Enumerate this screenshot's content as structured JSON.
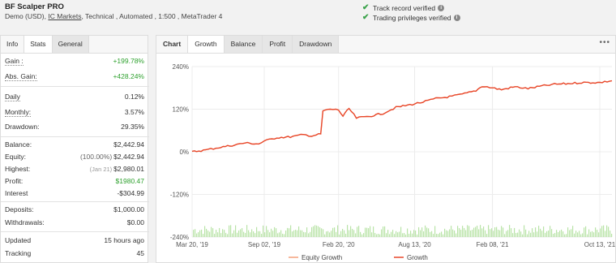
{
  "header": {
    "title": "BF Scalper PRO",
    "sub_pre": "Demo (USD),",
    "broker": "IC Markets",
    "sub_post": ", Technical , Automated , 1:500 , MetaTrader 4",
    "verified1": "Track record verified",
    "verified2": "Trading privileges verified"
  },
  "left": {
    "tabs": [
      "Info",
      "Stats",
      "General"
    ],
    "gain_label": "Gain :",
    "gain_value": "+199.78%",
    "abs_label": "Abs. Gain:",
    "abs_value": "+428.24%",
    "daily_label": "Daily",
    "daily_value": "0.12%",
    "monthly_label": "Monthly:",
    "monthly_value": "3.57%",
    "drawdown_label": "Drawdown:",
    "drawdown_value": "29.35%",
    "balance_label": "Balance:",
    "balance_value": "$2,442.94",
    "equity_label": "Equity:",
    "equity_pre": "(100.00%)",
    "equity_value": "$2,442.94",
    "highest_label": "Highest:",
    "highest_pre": "(Jan 21)",
    "highest_value": "$2,980.01",
    "profit_label": "Profit:",
    "profit_value": "$1980.47",
    "interest_label": "Interest",
    "interest_value": "-$304.99",
    "deposits_label": "Deposits:",
    "deposits_value": "$1,000.00",
    "withdrawals_label": "Withdrawals:",
    "withdrawals_value": "$0.00",
    "updated_label": "Updated",
    "updated_value": "15 hours ago",
    "tracking_label": "Tracking",
    "tracking_value": "45"
  },
  "chart_tabs": [
    "Chart",
    "Growth",
    "Balance",
    "Profit",
    "Drawdown"
  ],
  "chart_data": {
    "type": "line",
    "title": "",
    "xlabel": "",
    "ylabel": "",
    "x_ticks": [
      "Mar 20, '19",
      "Sep 02, '19",
      "Feb 20, '20",
      "Aug 13, '20",
      "Feb 08, '21",
      "Oct 13, '21"
    ],
    "y_ticks": [
      "240%",
      "120%",
      "0%",
      "-120%",
      "-240%"
    ],
    "ylim": [
      -240,
      240
    ],
    "legend": [
      "Equity Growth",
      "Growth"
    ],
    "legend_position": "bottom",
    "colors": {
      "equity": "#f4a07a",
      "growth": "#e8472a",
      "bars": "#b9e3a7"
    },
    "series": [
      {
        "name": "Growth",
        "x": [
          "2019-03-20",
          "2019-04-20",
          "2019-05-20",
          "2019-06-20",
          "2019-07-20",
          "2019-08-20",
          "2019-09-02",
          "2019-10-01",
          "2019-11-01",
          "2019-12-01",
          "2019-12-20",
          "2020-01-10",
          "2020-01-15",
          "2020-02-01",
          "2020-02-20",
          "2020-03-01",
          "2020-03-15",
          "2020-04-01",
          "2020-05-01",
          "2020-06-01",
          "2020-07-01",
          "2020-08-13",
          "2020-09-01",
          "2020-10-01",
          "2020-11-01",
          "2020-12-01",
          "2021-01-01",
          "2021-01-15",
          "2021-02-08",
          "2021-03-01",
          "2021-04-01",
          "2021-05-01",
          "2021-06-01",
          "2021-07-01",
          "2021-08-01",
          "2021-09-01",
          "2021-10-13",
          "2021-11-10"
        ],
        "y": [
          0,
          5,
          12,
          18,
          25,
          22,
          30,
          40,
          42,
          48,
          45,
          50,
          115,
          120,
          118,
          100,
          122,
          95,
          100,
          108,
          125,
          135,
          140,
          150,
          155,
          162,
          172,
          185,
          180,
          175,
          183,
          178,
          185,
          190,
          192,
          195,
          195,
          200
        ]
      }
    ]
  }
}
